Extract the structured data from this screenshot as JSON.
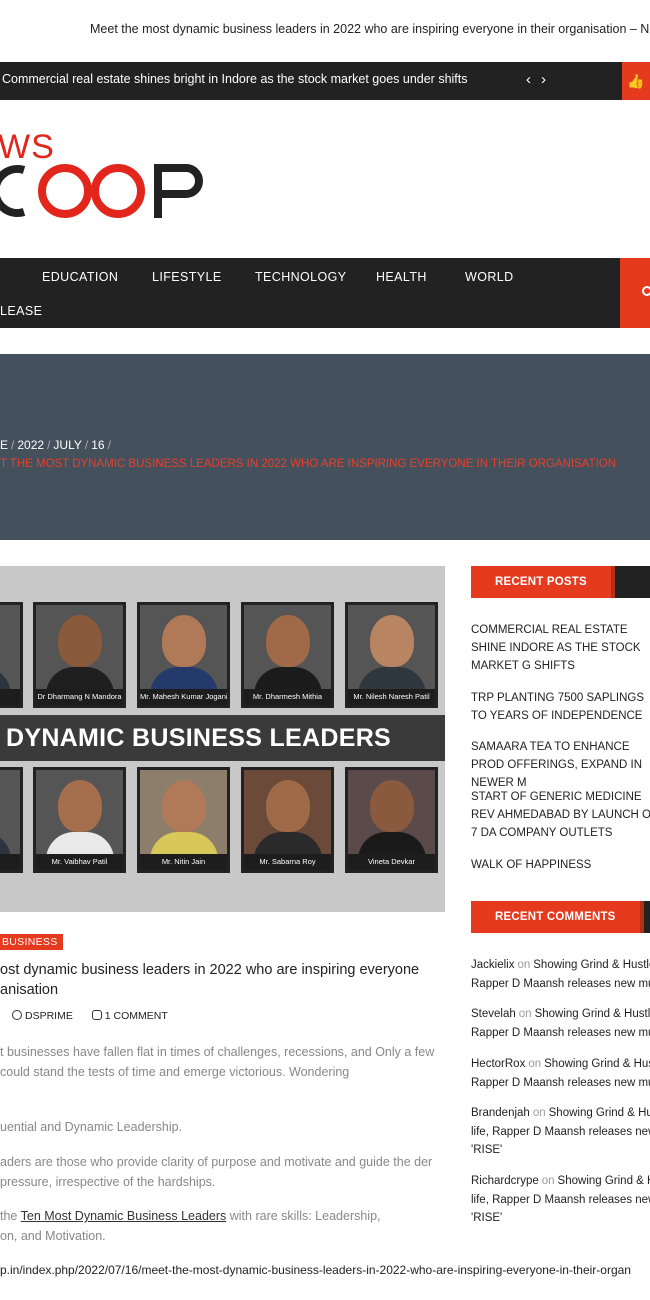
{
  "topline": "Meet the most dynamic business leaders in 2022 who are inspiring everyone in their organisation – Ne",
  "ticker": {
    "text": "Commercial real estate shines bright in Indore as the stock market goes under shifts",
    "prev": "‹",
    "next": "›"
  },
  "logo": {
    "top": "WS",
    "bottom": "SCOOP"
  },
  "nav": {
    "items": [
      "EDUCATION",
      "LIFESTYLE",
      "TECHNOLOGY",
      "HEALTH",
      "WORLD"
    ],
    "second_row": "LEASE"
  },
  "breadcrumb": {
    "parts": [
      "E",
      "2022",
      "JULY",
      "16"
    ],
    "current": "T THE MOST DYNAMIC BUSINESS LEADERS IN 2022 WHO ARE INSPIRING EVERYONE IN THEIR ORGANISATION"
  },
  "feature": {
    "band_text": "DYNAMIC BUSINESS LEADERS",
    "top_row": [
      "harya",
      "Dr Dharmang N Mandora",
      "Mr. Mahesh Kumar Jogani",
      "Mr. Dharmesh Mithia",
      "Mr. Nilesh Naresh Patil"
    ],
    "bottom_row": [
      "r K",
      "Mr. Vaibhav Patil",
      "Mr. Nitin Jain",
      "Mr. Sabarna Roy",
      "Vineta Devkar"
    ]
  },
  "post": {
    "category": "BUSINESS",
    "title": "ost dynamic business leaders in 2022 who are inspiring everyone anisation",
    "author": "DSPRIME",
    "comments": "1 COMMENT",
    "p1": "t businesses have fallen flat in times of challenges, recessions, and Only a few could stand the tests of time and emerge victorious. Wondering",
    "p2": "uential and Dynamic Leadership.",
    "p3": "aders are those who provide clarity of purpose and motivate and guide the der pressure, irrespective of the hardships.",
    "p4_pre": " the ",
    "p4_link": "Ten Most Dynamic Business Leaders",
    "p4_post": " with rare skills: Leadership,",
    "p4_line2": "on, and Motivation."
  },
  "sidebar": {
    "recent_posts_title": "RECENT POSTS",
    "recent_posts": [
      "COMMERCIAL REAL ESTATE SHINE INDORE AS THE STOCK MARKET G SHIFTS",
      "TRP PLANTING 7500 SAPLINGS TO YEARS OF INDEPENDENCE",
      "SAMAARA TEA TO ENHANCE PROD OFFERINGS, EXPAND IN NEWER M",
      "START OF GENERIC MEDICINE REV AHMEDABAD BY LAUNCH OF 7 DA COMPANY OUTLETS",
      "WALK OF HAPPINESS"
    ],
    "recent_comments_title": "RECENT COMMENTS",
    "recent_comments": [
      {
        "author": "Jackielix",
        "on": "on",
        "post": "Showing Grind & Hustle Rapper D Maansh releases new mu"
      },
      {
        "author": "Stevelah",
        "on": "on",
        "post": "Showing Grind & Hustl Rapper D Maansh releases new mu"
      },
      {
        "author": "HectorRox",
        "on": "on",
        "post": "Showing Grind & Hus Rapper D Maansh releases new mu"
      },
      {
        "author": "Brandenjah",
        "on": "on",
        "post": "Showing Grind & Hu life, Rapper D Maansh releases new 'RISE'"
      },
      {
        "author": "Richardcrype",
        "on": "on",
        "post": "Showing Grind & H life, Rapper D Maansh releases new 'RISE'"
      }
    ]
  },
  "status_url": "p.in/index.php/2022/07/16/meet-the-most-dynamic-business-leaders-in-2022-who-are-inspiring-everyone-in-their-organ",
  "colors": {
    "accent": "#e63a1f",
    "dark": "#222222",
    "hero": "#44505c"
  }
}
